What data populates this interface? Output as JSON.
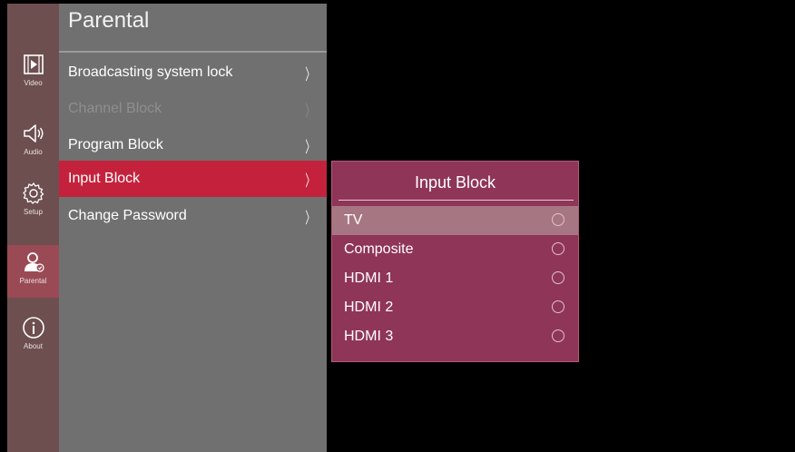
{
  "sidebar": {
    "items": [
      {
        "label": "Video",
        "icon": "video-icon"
      },
      {
        "label": "Audio",
        "icon": "speaker-icon"
      },
      {
        "label": "Setup",
        "icon": "gear-icon"
      },
      {
        "label": "Parental",
        "icon": "parental-user-icon",
        "active": true
      },
      {
        "label": "About",
        "icon": "info-icon"
      }
    ]
  },
  "menu": {
    "title": "Parental",
    "items": [
      {
        "label": "Broadcasting system lock",
        "chevron": "〉",
        "state": "normal"
      },
      {
        "label": "Channel Block",
        "chevron": "〉",
        "state": "disabled"
      },
      {
        "label": "Program Block",
        "chevron": "〉",
        "state": "normal"
      },
      {
        "label": "Input Block",
        "chevron": "〉",
        "state": "selected"
      },
      {
        "label": "Change Password",
        "chevron": "〉",
        "state": "normal"
      }
    ]
  },
  "popup": {
    "title": "Input Block",
    "options": [
      {
        "label": "TV",
        "checked": false,
        "highlighted": true
      },
      {
        "label": "Composite",
        "checked": false
      },
      {
        "label": "HDMI 1",
        "checked": false
      },
      {
        "label": "HDMI 2",
        "checked": false
      },
      {
        "label": "HDMI 3",
        "checked": false
      }
    ]
  },
  "colors": {
    "sidebar_bg": "#6e4f50",
    "sidebar_active": "#9a4a55",
    "menu_bg": "#707070",
    "menu_selected": "#c4223c",
    "popup_bg": "#8f3558",
    "popup_selected": "#a67782"
  }
}
